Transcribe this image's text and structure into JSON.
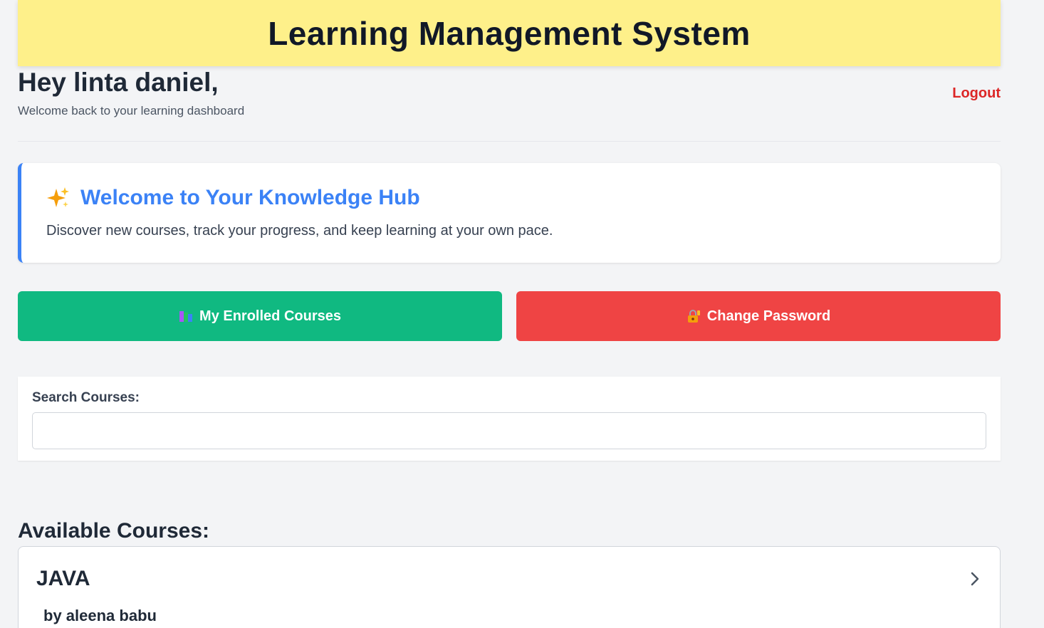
{
  "header": {
    "title": "Learning Management System"
  },
  "greeting": {
    "title": "Hey linta daniel,",
    "subtitle": "Welcome back to your learning dashboard",
    "logout_label": "Logout"
  },
  "hub": {
    "icon": "sparkles-icon",
    "title": "Welcome to Your Knowledge Hub",
    "text": "Discover new courses, track your progress, and keep learning at your own pace.",
    "accent_color": "#3b82f6"
  },
  "actions": {
    "enrolled": {
      "icon": "books-icon",
      "label": "My Enrolled Courses",
      "color": "#10b981"
    },
    "change_password": {
      "icon": "lock-key-icon",
      "label": "Change Password",
      "color": "#ef4444"
    }
  },
  "search": {
    "label": "Search Courses:",
    "value": "",
    "placeholder": ""
  },
  "courses": {
    "heading": "Available Courses:",
    "items": [
      {
        "name": "JAVA",
        "author": "by aleena babu"
      }
    ]
  }
}
